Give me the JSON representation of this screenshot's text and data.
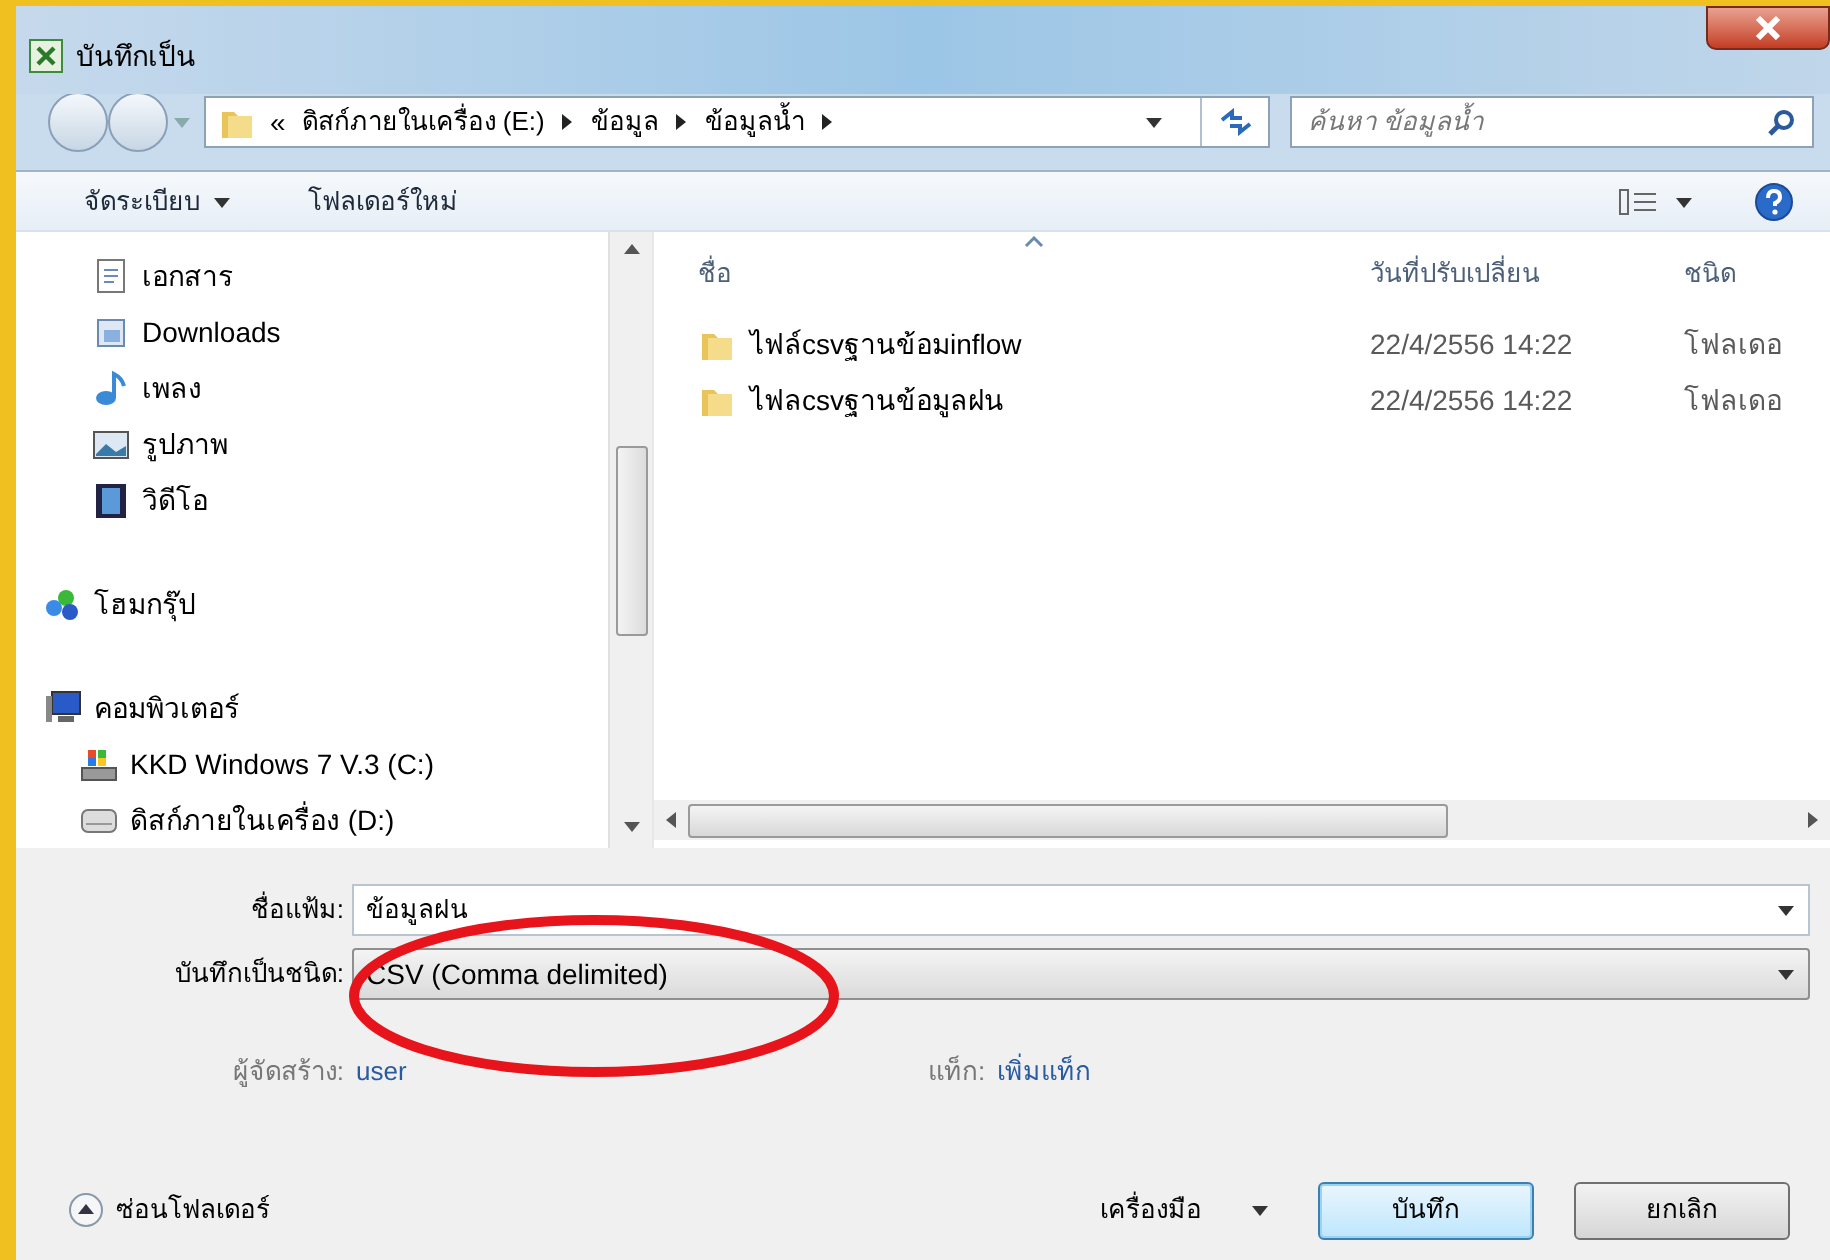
{
  "window": {
    "title": "บันทึกเป็น"
  },
  "address_bar": {
    "overflow": "«",
    "crumbs": [
      "ดิสก์ภายในเครื่อง (E:)",
      "ข้อมูล",
      "ข้อมูลน้ำ"
    ]
  },
  "search": {
    "placeholder": "ค้นหา ข้อมูลน้ำ"
  },
  "toolbar": {
    "organize": "จัดระเบียบ",
    "new_folder": "โฟลเดอร์ใหม่"
  },
  "navigation": {
    "items": [
      {
        "label": "เอกสาร",
        "kind": "documents"
      },
      {
        "label": "Downloads",
        "kind": "downloads"
      },
      {
        "label": "เพลง",
        "kind": "music"
      },
      {
        "label": "รูปภาพ",
        "kind": "pictures"
      },
      {
        "label": "วิดีโอ",
        "kind": "videos"
      },
      {
        "label": "โฮมกรุ๊ป",
        "kind": "homegroup"
      },
      {
        "label": "คอมพิวเตอร์",
        "kind": "computer"
      },
      {
        "label": "KKD Windows 7 V.3 (C:)",
        "kind": "system_drive"
      },
      {
        "label": "ดิสก์ภายในเครื่อง (D:)",
        "kind": "drive"
      }
    ]
  },
  "file_list": {
    "columns": [
      "ชื่อ",
      "วันที่ปรับเปลี่ยน",
      "ชนิด"
    ],
    "rows": [
      {
        "name": "ไฟล์csvฐานข้อมinflow",
        "modified": "22/4/2556 14:22",
        "type": "โฟลเดอ"
      },
      {
        "name": "ไฟลcsvฐานข้อมูลฝน",
        "modified": "22/4/2556 14:22",
        "type": "โฟลเดอ"
      }
    ]
  },
  "file_name": {
    "label": "ชื่อแฟ้ม:",
    "value": "ข้อมูลฝน"
  },
  "save_as_type": {
    "label": "บันทึกเป็นชนิด:",
    "value": "CSV (Comma delimited)"
  },
  "authors": {
    "label": "ผู้จัดสร้าง:",
    "value": "user"
  },
  "tags": {
    "label": "แท็ก:",
    "value": "เพิ่มแท็ก"
  },
  "hide_folders": "ซ่อนโฟลเดอร์",
  "tools": "เครื่องมือ",
  "buttons": [
    {
      "label": "บันทึก",
      "kind": "default"
    },
    {
      "label": "ยกเลิก",
      "kind": "normal"
    }
  ],
  "annotations": [
    {
      "kind": "ellipse"
    }
  ]
}
